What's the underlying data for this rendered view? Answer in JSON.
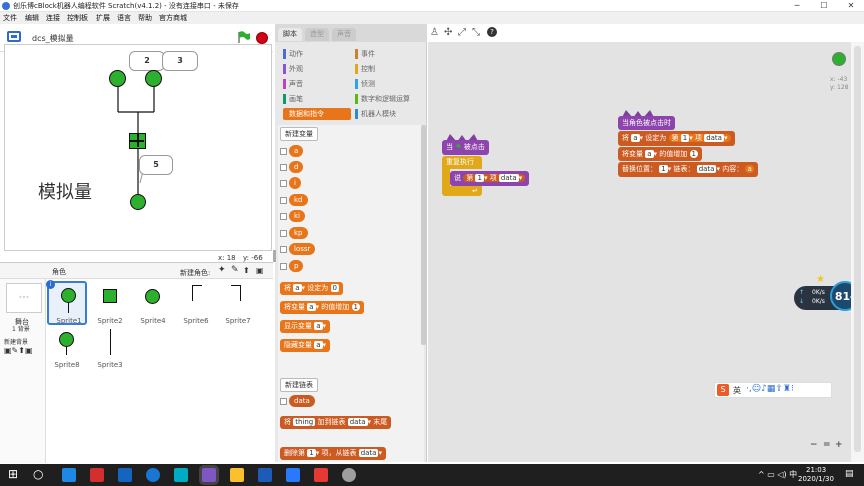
{
  "window": {
    "title": "创乐博cBlock机器人编程软件 Scratch(v4.1.2) - 没有连接串口 - 未保存",
    "controls": [
      "─",
      "☐",
      "✕"
    ]
  },
  "menu": [
    "文件",
    "编辑",
    "连接",
    "控制板",
    "扩展",
    "语言",
    "帮助",
    "官方商城"
  ],
  "stage": {
    "name": "dcs_模拟量",
    "label": "模拟量",
    "bubbles": [
      "2",
      "3",
      "5"
    ],
    "coord_x": "x: 18",
    "coord_y": "y: -66"
  },
  "sprites": {
    "header": "角色",
    "new_sprite": "新建角色:",
    "stage_label": "舞台",
    "stage_backdrops": "1 背景",
    "new_backdrop": "新建背景",
    "items": [
      "Sprite1",
      "Sprite2",
      "Sprite4",
      "Sprite6",
      "Sprite7",
      "Sprite8",
      "Sprite3"
    ]
  },
  "tabs": [
    "脚本",
    "造型",
    "声音"
  ],
  "categories_left": [
    "动作",
    "外观",
    "声音",
    "画笔",
    "数据和指令"
  ],
  "categories_right": [
    "事件",
    "控制",
    "侦测",
    "数字和逻辑运算",
    "机器人模块"
  ],
  "palette": {
    "new_var": "新建变量",
    "vars": [
      "a",
      "d",
      "i",
      "kd",
      "ki",
      "kp",
      "lossr",
      "p"
    ],
    "set_block": {
      "pre": "将",
      "var": "a",
      "mid": "设定为",
      "val": "0"
    },
    "change_block": {
      "pre": "将变量",
      "var": "a",
      "mid": "的值增加",
      "val": "1"
    },
    "show_block": {
      "pre": "显示变量",
      "var": "a"
    },
    "hide_block": {
      "pre": "隐藏变量",
      "var": "a"
    },
    "new_list": "新建链表",
    "list": "data",
    "add_block": {
      "pre": "将",
      "val": "thing",
      "mid": "加到链表",
      "list": "data",
      "post": "末尾"
    },
    "delete_block": {
      "pre": "删除第",
      "val": "1",
      "mid": "项，从链表",
      "list": "data"
    }
  },
  "scripts": {
    "script1": {
      "hat_pre": "当",
      "hat_post": "被点击",
      "loop": "重复执行",
      "say": "说",
      "item_pre": "第",
      "item_val": "1",
      "item_mid": "项",
      "item_list": "data"
    },
    "script2": {
      "hat": "当角色被点击时",
      "set_pre": "将",
      "set_var": "a",
      "set_mid": "设定为",
      "set_item_pre": "第",
      "set_item_val": "1",
      "set_item_mid": "项",
      "set_item_list": "data",
      "change_pre": "将变量",
      "change_var": "a",
      "change_mid": "的值增加",
      "change_val": "1",
      "replace_pre": "替换位置：",
      "replace_val": "1",
      "replace_mid": "链表：",
      "replace_list": "data",
      "replace_post": "内容：",
      "replace_var": "a"
    },
    "coord_x": "x: -43",
    "coord_y": "y: 128"
  },
  "net_widget": {
    "up": "0K/s",
    "down": "0K/s",
    "percent": "81"
  },
  "ime_bar": {
    "label": "英"
  },
  "zoom": [
    "−",
    "=",
    "+"
  ],
  "taskbar": {
    "time": "21:03",
    "date": "2020/1/30"
  }
}
